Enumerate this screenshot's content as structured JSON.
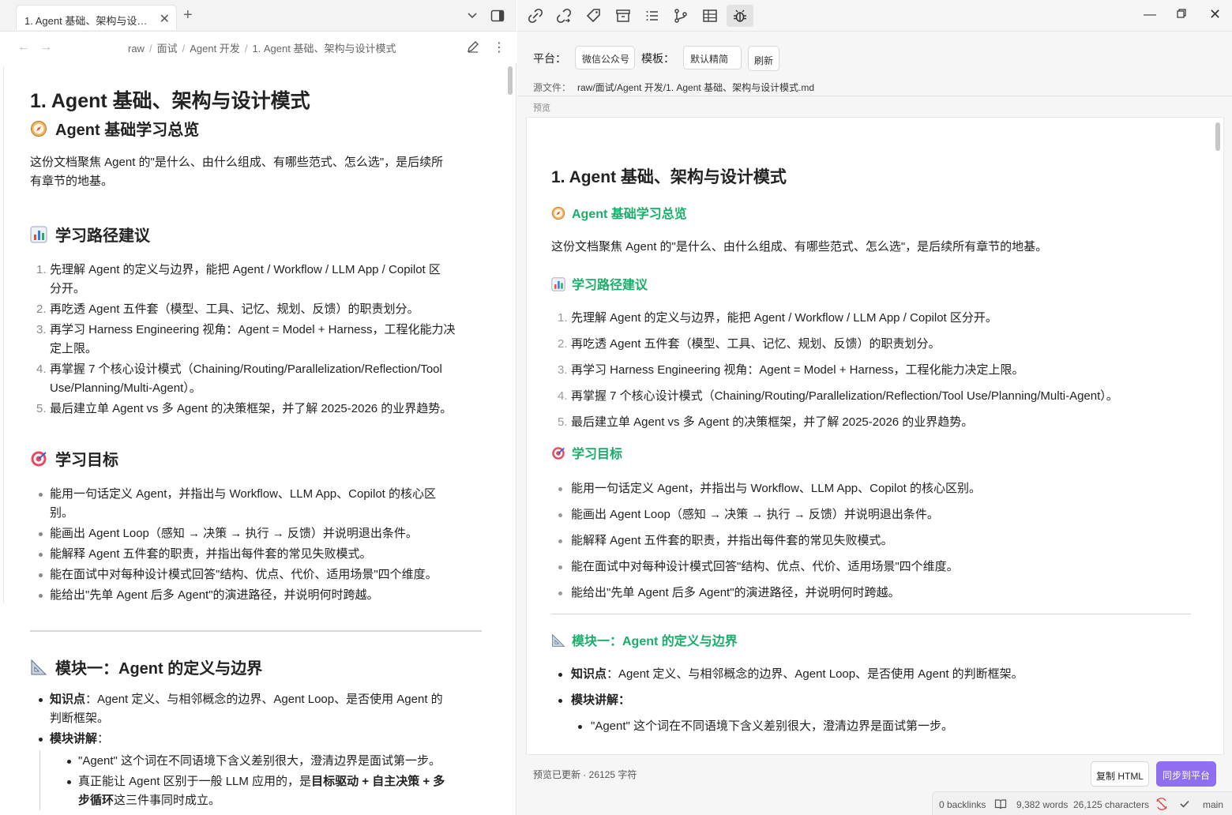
{
  "tab": {
    "title": "1. Agent 基础、架构与设…"
  },
  "breadcrumb": [
    "raw",
    "面试",
    "Agent 开发",
    "1. Agent 基础、架构与设计模式"
  ],
  "doc": {
    "title": "1. Agent 基础、架构与设计模式",
    "overview_heading": "Agent 基础学习总览",
    "overview_text": "这份文档聚焦 Agent 的\"是什么、由什么组成、有哪些范式、怎么选\"，是后续所有章节的地基。",
    "path_heading": "学习路径建议",
    "path_items": [
      "先理解 Agent 的定义与边界，能把 Agent / Workflow / LLM App / Copilot 区分开。",
      "再吃透 Agent 五件套（模型、工具、记忆、规划、反馈）的职责划分。",
      "再学习 Harness Engineering 视角：Agent = Model + Harness，工程化能力决定上限。",
      "再掌握 7 个核心设计模式（Chaining/Routing/Parallelization/Reflection/Tool Use/Planning/Multi-Agent）。",
      "最后建立单 Agent vs 多 Agent 的决策框架，并了解 2025-2026 的业界趋势。"
    ],
    "goals_heading": "学习目标",
    "goals_items": [
      "能用一句话定义 Agent，并指出与 Workflow、LLM App、Copilot 的核心区别。",
      "能画出 Agent Loop（感知 → 决策 → 执行 → 反馈）并说明退出条件。",
      "能解释 Agent 五件套的职责，并指出每件套的常见失败模式。",
      "能在面试中对每种设计模式回答\"结构、优点、代价、适用场景\"四个维度。",
      "能给出\"先单 Agent 后多 Agent\"的演进路径，并说明何时跨越。"
    ],
    "module1_heading": "模块一：Agent 的定义与边界",
    "knowledge_label": "知识点",
    "knowledge_text": "：Agent 定义、与相邻概念的边界、Agent Loop、是否使用 Agent 的判断框架。",
    "explain_label": "模块讲解",
    "explain_colon": "：",
    "sub1": "\"Agent\" 这个词在不同语境下含义差别很大，澄清边界是面试第一步。",
    "sub2_a": "真正能让 Agent 区别于一般 LLM 应用的，是",
    "sub2_b1": "目标驱动",
    "sub2_plus": " + ",
    "sub2_b2": "自主决策",
    "sub2_b3": "多步循环",
    "sub2_c": "这三件事同时成立。"
  },
  "left_wrap": {
    "overview_l1": "这份文档聚焦 Agent 的\"是什么、由什么组成、有哪些范式、怎么选\"，是后续所",
    "overview_l2": "有章节的地基。",
    "path": [
      [
        "先理解 Agent 的定义与边界，能把 Agent / Workflow / LLM App / Copilot 区",
        "分开。"
      ],
      [
        "再吃透 Agent 五件套（模型、工具、记忆、规划、反馈）的职责划分。",
        ""
      ],
      [
        "再学习 Harness Engineering 视角：Agent = Model + Harness，工程化能力决",
        "定上限。"
      ],
      [
        "再掌握 7 个核心设计模式（Chaining/Routing/Parallelization/Reflection/Tool",
        "Use/Planning/Multi-Agent）。"
      ],
      [
        "最后建立单 Agent vs 多 Agent 的决策框架，并了解 2025-2026 的业界趋势。",
        ""
      ]
    ],
    "goals": [
      [
        "能用一句话定义 Agent，并指出与 Workflow、LLM App、Copilot 的核心区",
        "别。"
      ],
      [
        "能画出 Agent Loop（感知 → 决策 → 执行 → 反馈）并说明退出条件。",
        ""
      ],
      [
        "能解释 Agent 五件套的职责，并指出每件套的常见失败模式。",
        ""
      ],
      [
        "能在面试中对每种设计模式回答\"结构、优点、代价、适用场景\"四个维度。",
        ""
      ],
      [
        "能给出\"先单 Agent 后多 Agent\"的演进路径，并说明何时跨越。",
        ""
      ]
    ],
    "knowledge_l1": "：Agent 定义、与相邻概念的边界、Agent Loop、是否使用 Agent 的",
    "knowledge_l2": "判断框架。",
    "sub2_line1_end": " + 多",
    "sub2_line2_b": "步循环"
  },
  "publish": {
    "platform_label": "平台：",
    "platform_value": "微信公众号",
    "template_label": "模板：",
    "template_value": "默认精简",
    "refresh_label": "刷新",
    "source_label": "源文件：",
    "source_path": "raw/面试/Agent 开发/1. Agent 基础、架构与设计模式.md",
    "preview_label": "预览",
    "status": "预览已更新 · 26125 字符",
    "copy_html": "复制 HTML",
    "sync": "同步到平台"
  },
  "statusbar": {
    "backlinks": "0 backlinks",
    "words": "9,382 words",
    "characters": "26,125 characters",
    "branch": "main"
  },
  "colors": {
    "accent_green": "#1aad6a",
    "sync_purple": "#8e6ff0"
  },
  "icons": [
    "compass-icon",
    "bar-chart-icon",
    "target-icon",
    "triangle-ruler-icon",
    "bug-icon"
  ]
}
